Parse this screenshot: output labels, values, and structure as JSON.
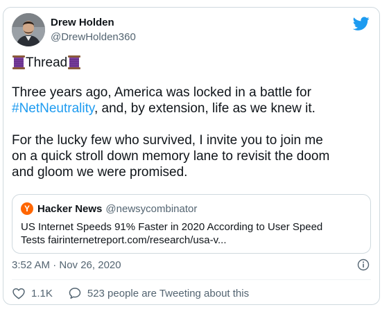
{
  "author": {
    "name": "Drew Holden",
    "handle": "@DrewHolden360"
  },
  "tweet": {
    "thread_label": "Thread",
    "para1_before": "Three years ago, America was locked in a battle for",
    "hashtag": "#NetNeutrality",
    "para1_after": ", and, by extension, life as we knew it.",
    "para2_lines": [
      "For the lucky few who survived, I invite you to join me",
      "on a quick stroll down memory lane to revisit the doom",
      "and gloom we were promised."
    ]
  },
  "quote": {
    "logo_letter": "Y",
    "name": "Hacker News",
    "handle": "@newsycombinator",
    "text_lines": [
      "US Internet Speeds 91% Faster in 2020 According to User Speed",
      "Tests fairinternetreport.com/research/usa-v..."
    ]
  },
  "meta": {
    "timestamp": "3:52 AM · Nov 26, 2020"
  },
  "actions": {
    "likes": "1.1K",
    "replies": "523 people are Tweeting about this"
  },
  "colors": {
    "link": "#1d9bf0",
    "text": "#0f1419",
    "secondary": "#536471",
    "border": "#cfd9de",
    "hn_orange": "#ff6600",
    "spool": "#7b3fa0"
  },
  "icons": {
    "brand": "twitter-bird-icon",
    "thread": "spool-of-thread-icon",
    "info": "info-icon",
    "like": "heart-icon",
    "reply": "speech-bubble-icon"
  }
}
